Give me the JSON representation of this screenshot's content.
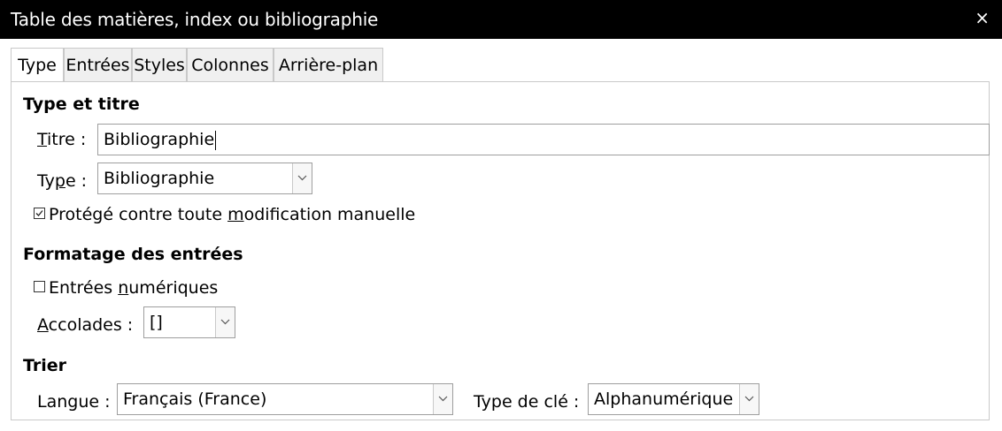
{
  "window": {
    "title": "Table des matières, index ou bibliographie",
    "close_glyph": "×"
  },
  "tabs": [
    {
      "label": "Type",
      "active": true
    },
    {
      "label": "Entrées",
      "active": false
    },
    {
      "label": "Styles",
      "active": false
    },
    {
      "label": "Colonnes",
      "active": false
    },
    {
      "label": "Arrière-plan",
      "active": false
    }
  ],
  "type_titre": {
    "heading": "Type et titre",
    "titre_label_mn": "T",
    "titre_label_rest": "itre :",
    "titre_value": "Bibliographie",
    "type_label_pre": "Ty",
    "type_label_mn": "p",
    "type_label_rest": "e :",
    "type_value": "Bibliographie",
    "protect_pre": "Protégé contre toute ",
    "protect_mn": "m",
    "protect_rest": "odification manuelle",
    "protect_checked": true
  },
  "formatage": {
    "heading": "Formatage des entrées",
    "numeric_pre": "Entrées ",
    "numeric_mn": "n",
    "numeric_rest": "umériques",
    "numeric_checked": false,
    "accolades_mn": "A",
    "accolades_rest": "ccolades :",
    "accolades_value": "[]"
  },
  "trier": {
    "heading": "Trier",
    "langue_label": "Langue :",
    "langue_value": "Français (France)",
    "cle_label": "Type de clé :",
    "cle_value": "Alphanumérique"
  },
  "icons": {
    "dropdown": "chevron-down-icon",
    "close": "close-icon",
    "check": "checkmark-icon"
  }
}
